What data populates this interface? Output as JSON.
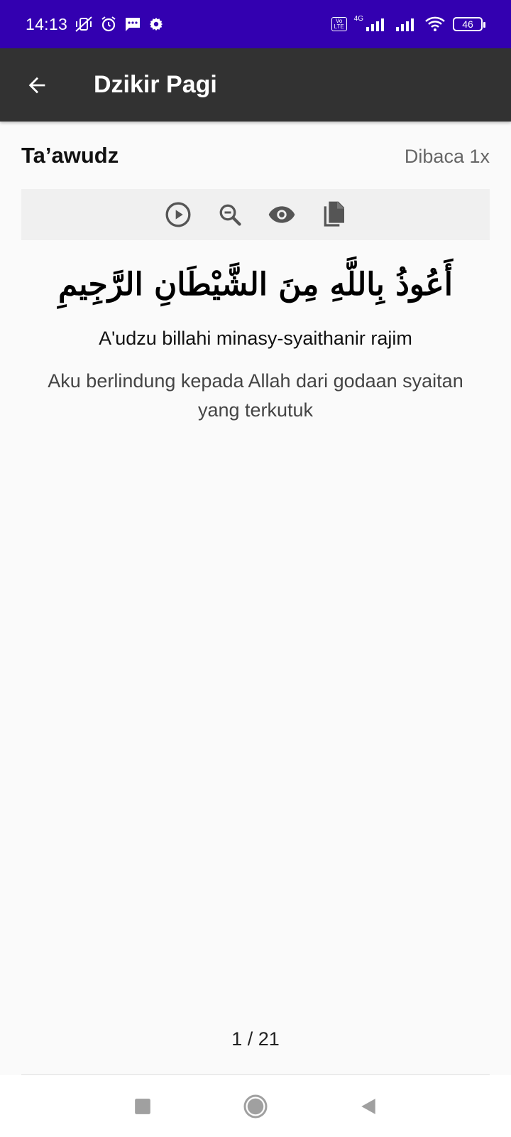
{
  "status_bar": {
    "time": "14:13",
    "battery": "46",
    "network": "4G",
    "volte_top": "Vo",
    "volte_bottom": "LTE"
  },
  "app_bar": {
    "title": "Dzikir Pagi",
    "back_icon": "arrow-back-icon"
  },
  "dzikir": {
    "title": "Ta’awudz",
    "count_label": "Dibaca 1x",
    "arabic": "أَعُوذُ بِاللَّهِ مِنَ الشَّيْطَانِ الرَّجِيمِ",
    "latin": "A'udzu billahi minasy-syaithanir rajim",
    "translation": "Aku berlindung kepada Allah dari godaan syaitan yang terkutuk"
  },
  "toolbar": {
    "icons": [
      "play-icon",
      "zoom-icon",
      "eye-icon",
      "copy-icon"
    ]
  },
  "pager": {
    "text": "1 / 21"
  },
  "colors": {
    "status_bar": "#3300b0",
    "app_bar": "#323232",
    "background": "#fafafa",
    "toolbar_bg": "#f0f0f0",
    "icon": "#555555"
  },
  "nav_bar": {
    "icons": [
      "recents-icon",
      "home-icon",
      "back-icon"
    ]
  }
}
